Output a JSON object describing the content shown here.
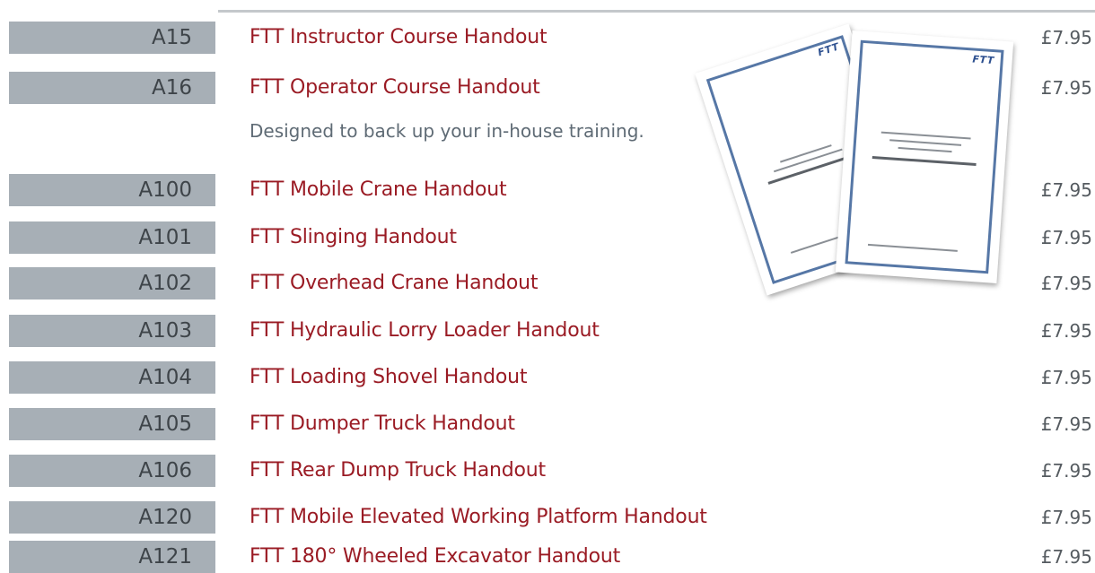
{
  "rows_top": [
    {
      "code": "A15",
      "name": "FTT Instructor Course Handout",
      "price": "£7.95"
    },
    {
      "code": "A16",
      "name": "FTT Operator Course Handout",
      "price": "£7.95"
    }
  ],
  "note": "Designed to back up your in-house training.",
  "rows_bottom": [
    {
      "code": "A100",
      "name": "FTT Mobile Crane Handout",
      "price": "£7.95"
    },
    {
      "code": "A101",
      "name": "FTT Slinging Handout",
      "price": "£7.95"
    },
    {
      "code": "A102",
      "name": "FTT Overhead Crane Handout",
      "price": "£7.95"
    },
    {
      "code": "A103",
      "name": "FTT Hydraulic Lorry Loader Handout",
      "price": "£7.95"
    },
    {
      "code": "A104",
      "name": "FTT Loading Shovel Handout",
      "price": "£7.95"
    },
    {
      "code": "A105",
      "name": "FTT Dumper Truck Handout",
      "price": "£7.95"
    },
    {
      "code": "A106",
      "name": "FTT Rear Dump Truck Handout",
      "price": "£7.95"
    },
    {
      "code": "A120",
      "name": "FTT Mobile Elevated Working Platform Handout",
      "price": "£7.95"
    },
    {
      "code": "A121",
      "name": "FTT 180° Wheeled Excavator Handout",
      "price": "£7.95"
    }
  ],
  "image": {
    "logo": "FTT",
    "colors": {
      "frame": "#5677a6",
      "code_bg": "#a7afb6",
      "name_text": "#9a1b24"
    }
  }
}
